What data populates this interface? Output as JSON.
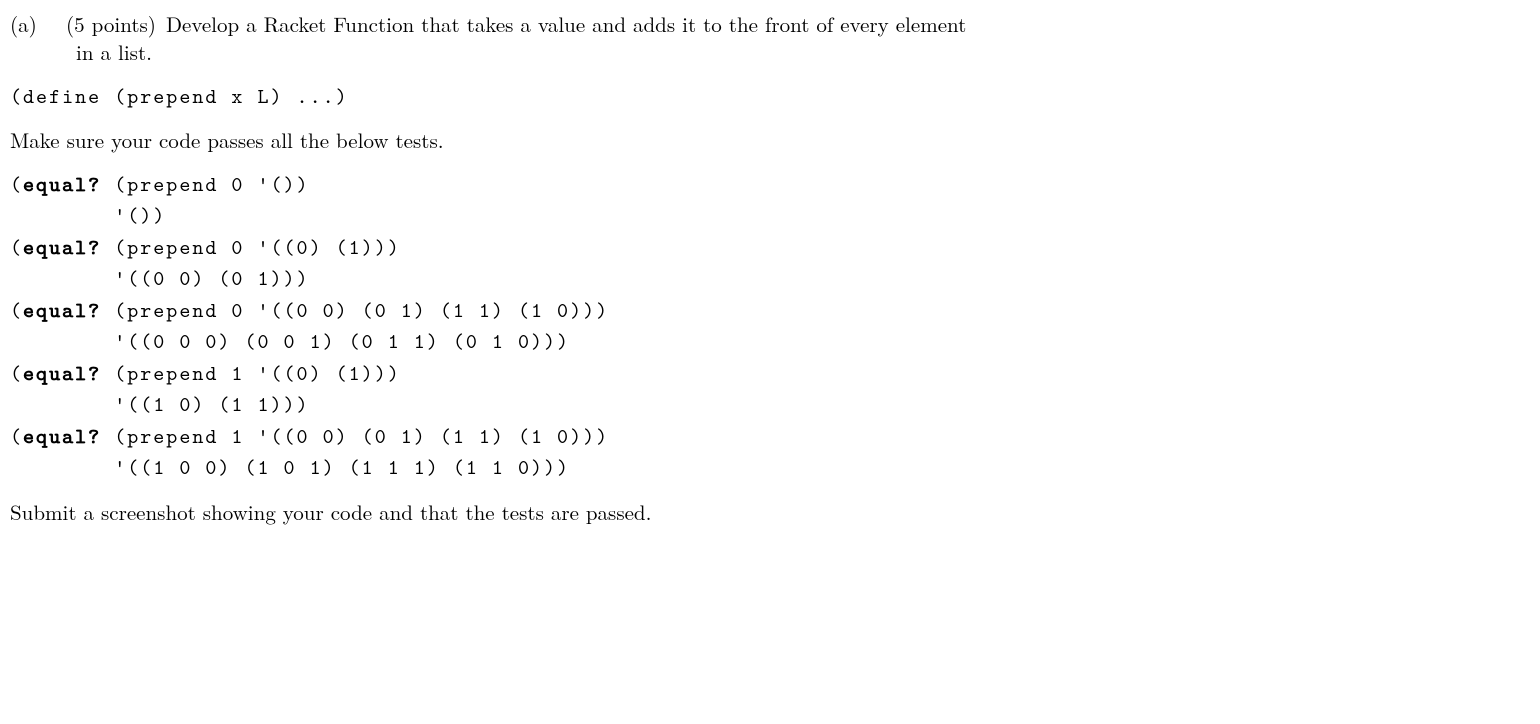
{
  "problem": {
    "label": "(a)",
    "points": "(5 points)",
    "prompt_line1": "Develop a Racket Function that takes a value and adds it to the front of every element",
    "prompt_line2": "in a list."
  },
  "signature_code": "(define (prepend x L) ...)",
  "instruction": "Make sure your code passes all the below tests.",
  "tests_code": "(equal? (prepend 0 '())\n        '())\n(equal? (prepend 0 '((0) (1)))\n        '((0 0) (0 1)))\n(equal? (prepend 0 '((0 0) (0 1) (1 1) (1 0)))\n        '((0 0 0) (0 0 1) (0 1 1) (0 1 0)))\n(equal? (prepend 1 '((0) (1)))\n        '((1 0) (1 1)))\n(equal? (prepend 1 '((0 0) (0 1) (1 1) (1 0)))\n        '((1 0 0) (1 0 1) (1 1 1) (1 1 0)))",
  "submission_note": "Submit a screenshot showing your code and that the tests are passed."
}
